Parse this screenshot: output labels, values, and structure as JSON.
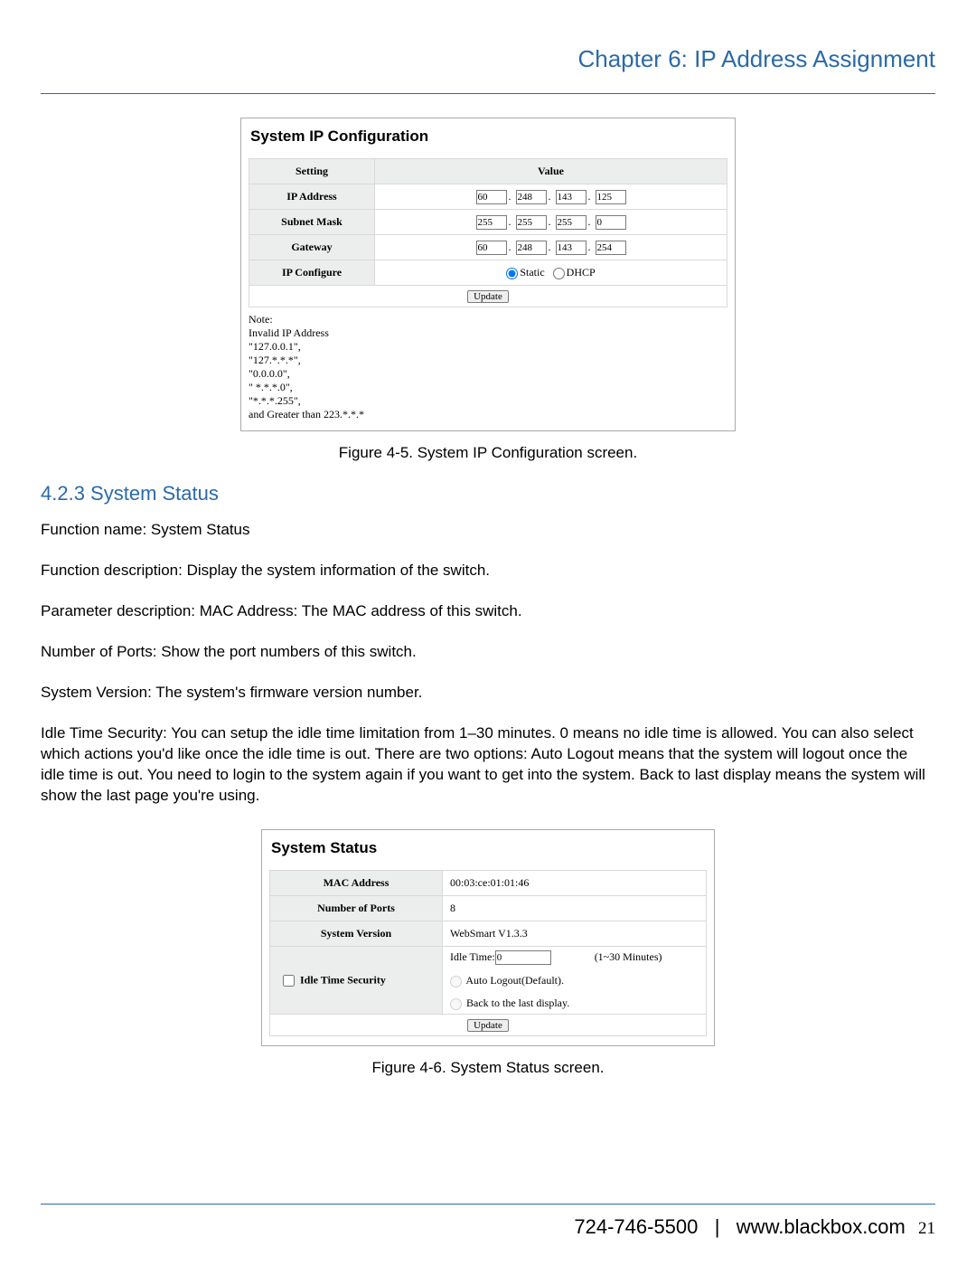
{
  "header": {
    "chapter": "Chapter 6: IP Address Assignment"
  },
  "fig1": {
    "title": "System IP Configuration",
    "th_setting": "Setting",
    "th_value": "Value",
    "row_ip_label": "IP Address",
    "ip": [
      "60",
      "248",
      "143",
      "125"
    ],
    "row_subnet_label": "Subnet Mask",
    "subnet": [
      "255",
      "255",
      "255",
      "0"
    ],
    "row_gw_label": "Gateway",
    "gw": [
      "60",
      "248",
      "143",
      "254"
    ],
    "row_cfg_label": "IP Configure",
    "radio_static": "Static",
    "radio_dhcp": "DHCP",
    "update": "Update",
    "note": "Note:\nInvalid IP Address\n\"127.0.0.1\",\n\"127.*.*.*\",\n\"0.0.0.0\",\n\" *.*.*.0\",\n\"*.*.*.255\",\nand Greater than 223.*.*.*",
    "caption": "Figure 4-5. System IP Configuration screen."
  },
  "section": {
    "heading": "4.2.3 System Status",
    "p1": "Function name:  System Status",
    "p2": "Function description: Display the system information of the switch.",
    "p3": "Parameter description: MAC Address: The MAC address of this switch.",
    "p4": "Number of Ports: Show the port numbers of this switch.",
    "p5": "System Version: The system's firmware version number.",
    "p6": "Idle Time Security: You can setup the idle time limitation from 1–30 minutes. 0 means no idle time is allowed. You can also select which actions you'd like once the idle time is out. There are two options: Auto Logout means that the system will logout once the idle time is out. You need to login to the system again if you want to get into the system. Back to last display means the system will show the last page you're using."
  },
  "fig2": {
    "title": "System Status",
    "row_mac_label": "MAC Address",
    "mac": "00:03:ce:01:01:46",
    "row_ports_label": "Number of Ports",
    "ports": "8",
    "row_ver_label": "System Version",
    "version": "WebSmart V1.3.3",
    "row_idle_label": "Idle Time Security",
    "idle_label": "Idle Time:",
    "idle_value": "0",
    "idle_range": "(1~30 Minutes)",
    "opt_auto": "Auto Logout(Default).",
    "opt_back": "Back to the last display.",
    "update": "Update",
    "caption": "Figure 4-6. System Status screen."
  },
  "footer": {
    "phone": "724-746-5500",
    "sep": "|",
    "url": "www.blackbox.com",
    "page": "21"
  }
}
